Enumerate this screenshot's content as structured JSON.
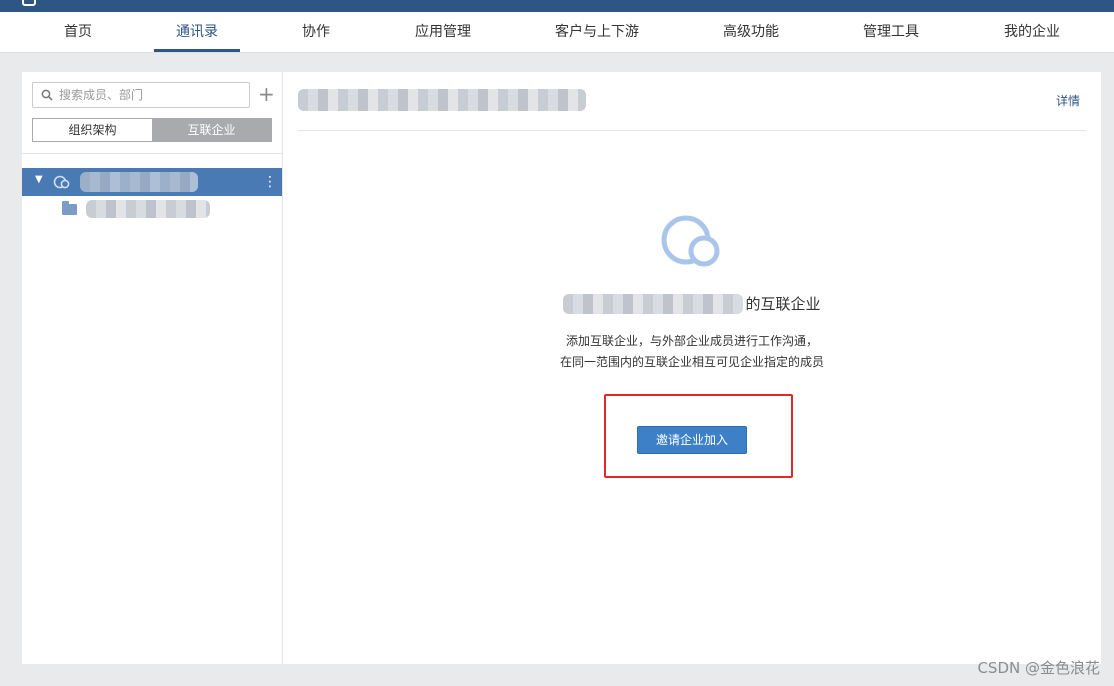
{
  "nav": {
    "tabs": [
      {
        "label": "首页",
        "active": false
      },
      {
        "label": "通讯录",
        "active": true
      },
      {
        "label": "协作",
        "active": false
      },
      {
        "label": "应用管理",
        "active": false
      },
      {
        "label": "客户与上下游",
        "active": false
      },
      {
        "label": "高级功能",
        "active": false
      },
      {
        "label": "管理工具",
        "active": false
      },
      {
        "label": "我的企业",
        "active": false
      }
    ]
  },
  "sidebar": {
    "search_placeholder": "搜索成员、部门",
    "add_symbol": "+",
    "segments": [
      {
        "label": "组织架构",
        "active": false
      },
      {
        "label": "互联企业",
        "active": true
      }
    ],
    "tree_more_symbol": "⋮"
  },
  "main": {
    "detail_link": "详情",
    "empty_title_suffix": "的互联企业",
    "description_lines": [
      "添加互联企业，与外部企业成员进行工作沟通，",
      "在同一范围内的互联企业相互可见企业指定的成员"
    ],
    "invite_button": "邀请企业加入"
  },
  "watermark": "CSDN @金色浪花",
  "colors": {
    "header": "#2e5685",
    "accent": "#3d80c7",
    "tree_selected": "#4a7ab3",
    "highlight_frame": "#e02a2a"
  },
  "icons": [
    "search-icon",
    "plus-icon",
    "link-circles-icon",
    "folder-icon",
    "more-vertical-icon"
  ]
}
